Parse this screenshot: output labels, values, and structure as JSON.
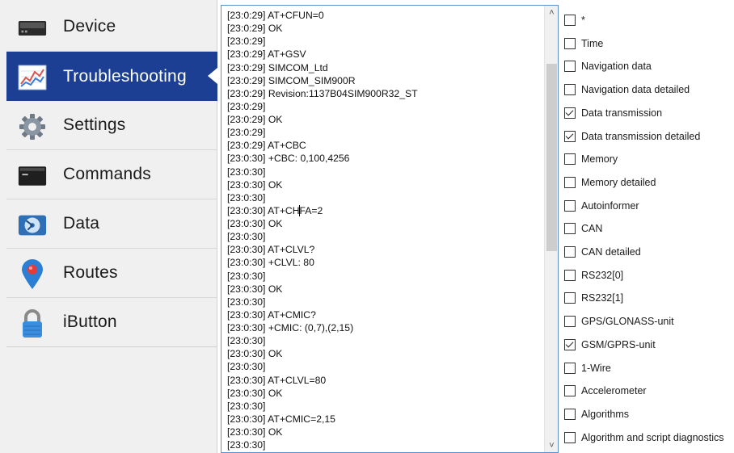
{
  "sidebar": {
    "items": [
      {
        "label": "Device",
        "icon": "device-icon",
        "active": false
      },
      {
        "label": "Troubleshooting",
        "icon": "troubleshooting-chart-icon",
        "active": true
      },
      {
        "label": "Settings",
        "icon": "gear-icon",
        "active": false
      },
      {
        "label": "Commands",
        "icon": "terminal-icon",
        "active": false
      },
      {
        "label": "Data",
        "icon": "data-disk-icon",
        "active": false
      },
      {
        "label": "Routes",
        "icon": "map-pin-icon",
        "active": false
      },
      {
        "label": "iButton",
        "icon": "padlock-icon",
        "active": false
      }
    ]
  },
  "log": {
    "lines": [
      "[23:0:29] AT+CFUN=0",
      "[23:0:29] OK",
      "[23:0:29]",
      "[23:0:29] AT+GSV",
      "[23:0:29] SIMCOM_Ltd",
      "[23:0:29] SIMCOM_SIM900R",
      "[23:0:29] Revision:1137B04SIM900R32_ST",
      "[23:0:29]",
      "[23:0:29] OK",
      "[23:0:29]",
      "[23:0:29] AT+CBC",
      "[23:0:30] +CBC: 0,100,4256",
      "[23:0:30]",
      "[23:0:30] OK",
      "[23:0:30]",
      "[23:0:30] AT+CHFA=2",
      "[23:0:30] OK",
      "[23:0:30]",
      "[23:0:30] AT+CLVL?",
      "[23:0:30] +CLVL: 80",
      "[23:0:30]",
      "[23:0:30] OK",
      "[23:0:30]",
      "[23:0:30] AT+CMIC?",
      "[23:0:30] +CMIC: (0,7),(2,15)",
      "[23:0:30]",
      "[23:0:30] OK",
      "[23:0:30]",
      "[23:0:30] AT+CLVL=80",
      "[23:0:30] OK",
      "[23:0:30]",
      "[23:0:30] AT+CMIC=2,15",
      "[23:0:30] OK",
      "[23:0:30]"
    ]
  },
  "filters": [
    {
      "label": "*",
      "checked": false
    },
    {
      "label": "Time",
      "checked": false
    },
    {
      "label": "Navigation data",
      "checked": false
    },
    {
      "label": "Navigation data detailed",
      "checked": false
    },
    {
      "label": "Data transmission",
      "checked": true
    },
    {
      "label": "Data transmission detailed",
      "checked": true
    },
    {
      "label": "Memory",
      "checked": false
    },
    {
      "label": "Memory detailed",
      "checked": false
    },
    {
      "label": "Autoinformer",
      "checked": false
    },
    {
      "label": "CAN",
      "checked": false
    },
    {
      "label": "CAN detailed",
      "checked": false
    },
    {
      "label": "RS232[0]",
      "checked": false
    },
    {
      "label": "RS232[1]",
      "checked": false
    },
    {
      "label": "GPS/GLONASS-unit",
      "checked": false
    },
    {
      "label": "GSM/GPRS-unit",
      "checked": true
    },
    {
      "label": "1-Wire",
      "checked": false
    },
    {
      "label": "Accelerometer",
      "checked": false
    },
    {
      "label": "Algorithms",
      "checked": false
    },
    {
      "label": "Algorithm and script diagnostics",
      "checked": false
    }
  ],
  "colors": {
    "active_nav": "#1c3f94",
    "log_border": "#5a8fd0"
  }
}
